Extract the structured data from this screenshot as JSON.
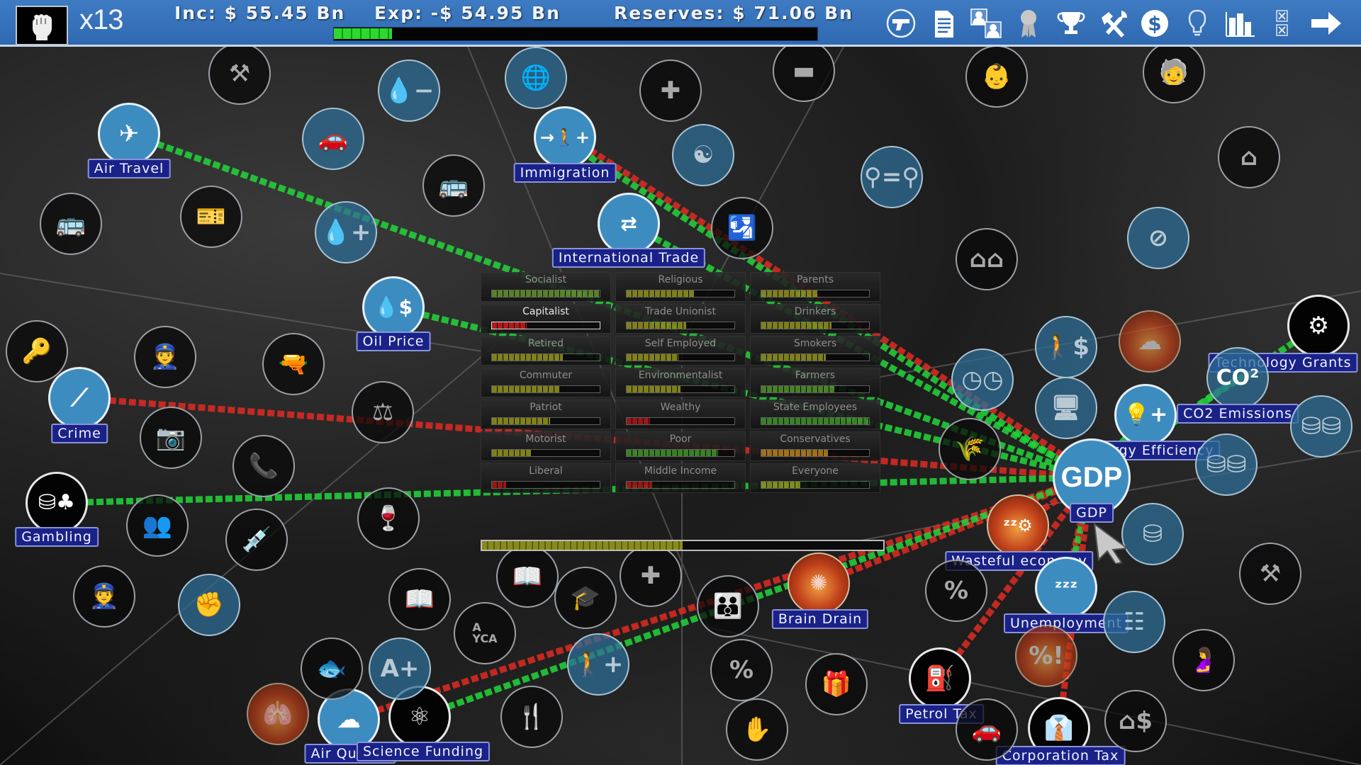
{
  "topbar": {
    "political_capital_icon": "raised-fist-icon",
    "multiplier": "x13",
    "income": "Inc: $ 55.45 Bn",
    "expenses": "Exp: -$ 54.95 Bn",
    "reserves": "Reserves: $ 71.06 Bn",
    "budget_bar_fill": 0.12,
    "buttons": [
      {
        "id": "police",
        "icon": "pistol-icon"
      },
      {
        "id": "reports",
        "icon": "document-icon"
      },
      {
        "id": "cabinet",
        "icon": "ministers-icon"
      },
      {
        "id": "ribbon",
        "icon": "award-ribbon-icon"
      },
      {
        "id": "achievements",
        "icon": "trophy-icon"
      },
      {
        "id": "tools",
        "icon": "tools-icon"
      },
      {
        "id": "finance",
        "icon": "dollar-coin-icon"
      },
      {
        "id": "ideas",
        "icon": "lightbulb-icon"
      },
      {
        "id": "statistics",
        "icon": "bar-chart-icon"
      },
      {
        "id": "cancel",
        "icon": "x-boxes-icon"
      },
      {
        "id": "next_turn",
        "icon": "arrow-right-icon"
      }
    ]
  },
  "focus_node": {
    "label": "GDP",
    "glyph": "GDP"
  },
  "labeled_nodes": [
    {
      "id": "air_travel",
      "label": "Air Travel",
      "icon": "airplane-icon",
      "link": "positive"
    },
    {
      "id": "immigration",
      "label": "Immigration",
      "icon": "immigration-icon",
      "link": "mixed"
    },
    {
      "id": "international_trade",
      "label": "International Trade",
      "icon": "cargo-ship-icon",
      "link": "positive"
    },
    {
      "id": "oil_price",
      "label": "Oil Price",
      "icon": "oil-price-icon",
      "link": "positive"
    },
    {
      "id": "crime",
      "label": "Crime",
      "icon": "crowbar-icon",
      "link": "negative"
    },
    {
      "id": "gambling",
      "label": "Gambling",
      "icon": "chips-cards-icon",
      "link": "positive"
    },
    {
      "id": "technology_grants",
      "label": "Technology Grants",
      "icon": "gear-hand-icon",
      "link": "positive"
    },
    {
      "id": "co2_emissions",
      "label": "CO2 Emissions",
      "icon": "co2-icon",
      "link": "positive"
    },
    {
      "id": "energy_efficiency",
      "label": "Energy Efficiency",
      "icon": "lightbulb-plus-icon",
      "link": "positive"
    },
    {
      "id": "gdp",
      "label": "GDP",
      "icon": "gdp-icon"
    },
    {
      "id": "wasteful_economy",
      "label": "Wasteful economy",
      "icon": "sleeping-gear-icon",
      "link": "negative"
    },
    {
      "id": "brain_drain",
      "label": "Brain Drain",
      "icon": "brain-icon",
      "link": "negative"
    },
    {
      "id": "unemployment",
      "label": "Unemployment",
      "icon": "sleeping-worker-icon",
      "link": "mixed"
    },
    {
      "id": "petrol_tax",
      "label": "Petrol Tax",
      "icon": "fuel-pump-icon",
      "link": "negative"
    },
    {
      "id": "corporation_tax",
      "label": "Corporation Tax",
      "icon": "businessman-icon",
      "link": "negative"
    },
    {
      "id": "air_quality",
      "label": "Air Quality",
      "icon": "cloud-icon",
      "link": "negative"
    },
    {
      "id": "science_funding",
      "label": "Science Funding",
      "icon": "atom-icon",
      "link": "positive"
    }
  ],
  "voter_groups": [
    {
      "name": "Socialist",
      "fill": 1.0,
      "color": "#5e8a2a"
    },
    {
      "name": "Religious",
      "fill": 0.63,
      "color": "#8a8a1c"
    },
    {
      "name": "Parents",
      "fill": 0.52,
      "color": "#8a8a1c"
    },
    {
      "name": "Capitalist",
      "fill": 0.32,
      "color": "#c01818",
      "selected": true
    },
    {
      "name": "Trade Unionist",
      "fill": 0.55,
      "color": "#8a8a1c"
    },
    {
      "name": "Drinkers",
      "fill": 0.65,
      "color": "#8a8a1c"
    },
    {
      "name": "Retired",
      "fill": 0.66,
      "color": "#8a8a1c"
    },
    {
      "name": "Self Employed",
      "fill": 0.48,
      "color": "#8a8a1c"
    },
    {
      "name": "Smokers",
      "fill": 0.6,
      "color": "#8a8a1c"
    },
    {
      "name": "Commuter",
      "fill": 0.63,
      "color": "#8a8a1c"
    },
    {
      "name": "Environmentalist",
      "fill": 0.5,
      "color": "#8a8a1c"
    },
    {
      "name": "Farmers",
      "fill": 0.68,
      "color": "#4f8a2a"
    },
    {
      "name": "Patriot",
      "fill": 0.54,
      "color": "#8a8a1c"
    },
    {
      "name": "Wealthy",
      "fill": 0.22,
      "color": "#a01818"
    },
    {
      "name": "State Employees",
      "fill": 1.0,
      "color": "#3f8a2a"
    },
    {
      "name": "Motorist",
      "fill": 0.37,
      "color": "#8a8a1c"
    },
    {
      "name": "Poor",
      "fill": 0.85,
      "color": "#3f8a2a"
    },
    {
      "name": "Conservatives",
      "fill": 0.62,
      "color": "#a07a1c"
    },
    {
      "name": "Liberal",
      "fill": 0.13,
      "color": "#a01818"
    },
    {
      "name": "Middle Income",
      "fill": 0.24,
      "color": "#a01818"
    },
    {
      "name": "Everyone",
      "fill": 0.36,
      "color": "#8a8a1c"
    }
  ],
  "overall_approval": 0.5,
  "unlabeled_nodes": [
    "road-works-icon",
    "water-minus-icon",
    "car-icon",
    "bus-lane-icon",
    "bus-icon",
    "bus-ticket-icon",
    "water-plus-icon",
    "globe-icon",
    "army-medic-icon",
    "tank-icon",
    "yin-yang-icon",
    "border-guard-icon",
    "baby-icon",
    "elderly-icon",
    "equality-icon",
    "retirement-home-icon",
    "no-drugs-icon",
    "housing-icon",
    "prison-icon",
    "police-officer-icon",
    "handgun-icon",
    "jury-icon",
    "cctv-icon",
    "informant-icon",
    "police-force-icon",
    "drug-syringe-icon",
    "alcohol-icon",
    "armed-police-icon",
    "fist-icon",
    "library-icon",
    "book-icon",
    "graduation-icon",
    "healthcare-icon",
    "eye-chart-icon",
    "family-icon",
    "evolution-fish-icon",
    "school-grade-icon",
    "child-benefit-icon",
    "cutlery-icon",
    "percent-icon",
    "gift-icon",
    "hand-cigarette-icon",
    "tax-bag-icon",
    "percent-alert-icon",
    "coins-icon",
    "tools-icon",
    "organisation-icon",
    "pregnant-icon",
    "property-tax-icon",
    "car-tax-icon",
    "lungs-icon",
    "computer-icon",
    "pollution-icon",
    "benefit-dollar-icon",
    "clocks-icon",
    "agriculture-icon",
    "coins-stack-icon",
    "coins-stack-2-icon",
    "co2-node-icon"
  ]
}
